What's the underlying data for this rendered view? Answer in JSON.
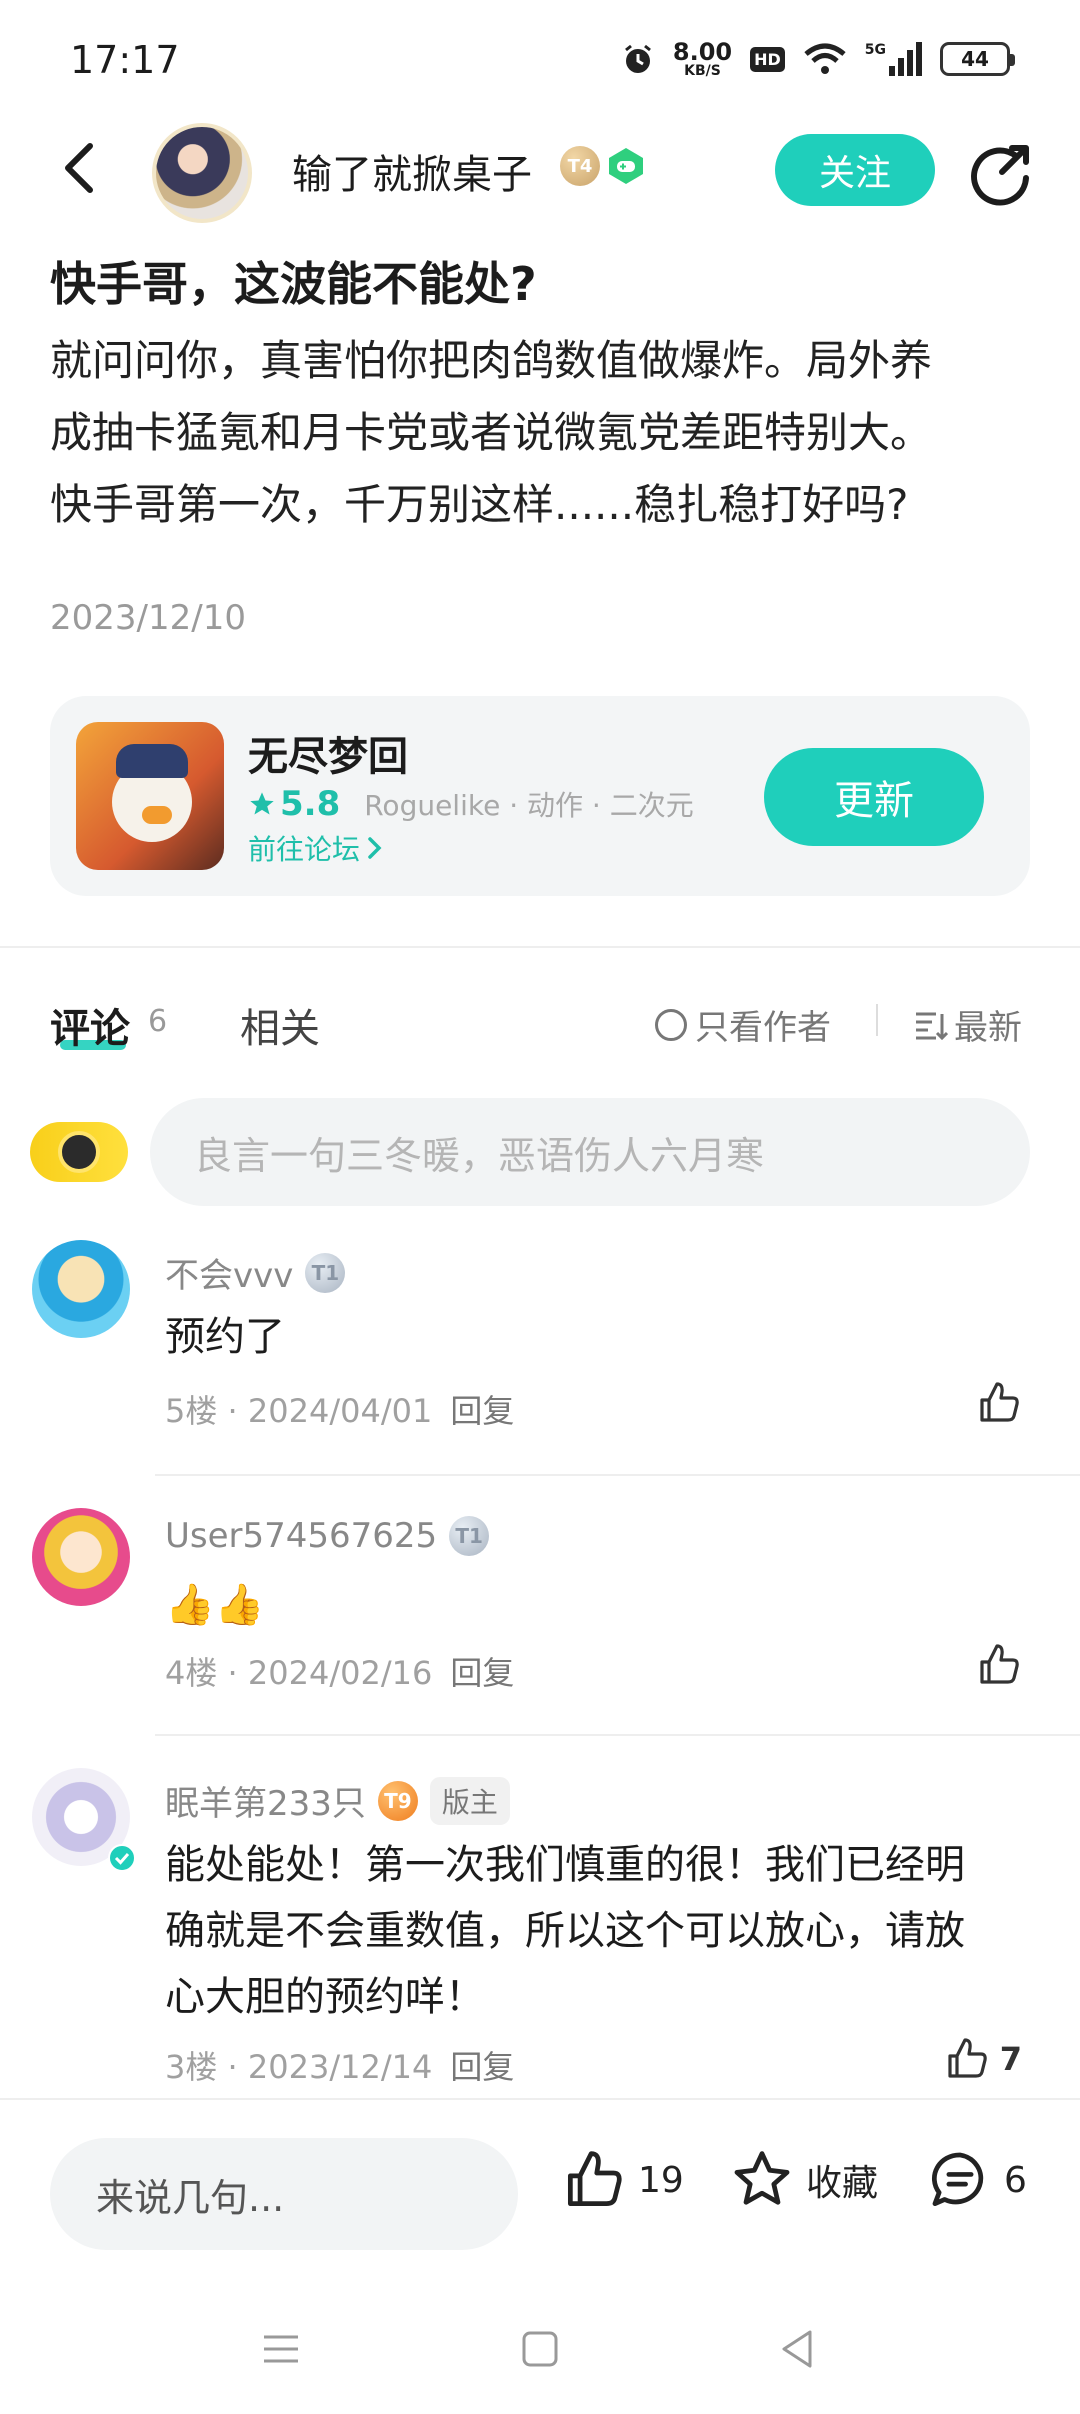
{
  "status": {
    "time": "17:17",
    "net_speed": "8.00",
    "net_unit": "KB/S",
    "hd": "HD",
    "signal": "5G",
    "battery": "44"
  },
  "header": {
    "author_name": "输了就掀桌子",
    "level_badge": "T4",
    "follow_label": "关注"
  },
  "post": {
    "title": "快手哥，这波能不能处?",
    "body_lines": [
      "就问问你，真害怕你把肉鸽数值做爆炸。局外养",
      "成抽卡猛氪和月卡党或者说微氪党差距特别大。",
      "快手哥第一次，千万别这样......稳扎稳打好吗?"
    ],
    "date": "2023/12/10"
  },
  "game": {
    "name": "无尽梦回",
    "rating": "5.8",
    "tags": "Roguelike · 动作 · 二次元",
    "forum_link": "前往论坛",
    "update_label": "更新"
  },
  "tabs": {
    "comments": "评论",
    "comment_count": "6",
    "related": "相关",
    "only_author": "只看作者",
    "sort": "最新"
  },
  "comment_input": {
    "placeholder": "良言一句三冬暖，恶语伤人六月寒"
  },
  "comments": [
    {
      "user": "不会vvv",
      "badge": "T1",
      "text": "预约了",
      "floor": "5楼",
      "date": "2024/04/01",
      "reply": "回复",
      "likes": ""
    },
    {
      "user": "User574567625",
      "badge": "T1",
      "text": "👍👍",
      "floor": "4楼",
      "date": "2024/02/16",
      "reply": "回复",
      "likes": ""
    },
    {
      "user": "眠羊第233只",
      "badge": "T9",
      "mod": "版主",
      "text_lines": [
        "能处能处！第一次我们慎重的很！我们已经明",
        "确就是不会重数值，所以这个可以放心，请放",
        "心大胆的预约咩！"
      ],
      "floor": "3楼",
      "date": "2023/12/14",
      "reply": "回复",
      "likes": "7"
    }
  ],
  "bottom": {
    "say_placeholder": "来说几句...",
    "likes": "19",
    "favorite": "收藏",
    "comments": "6"
  },
  "colors": {
    "accent": "#1fcfbb",
    "muted": "#a0a0a0"
  }
}
